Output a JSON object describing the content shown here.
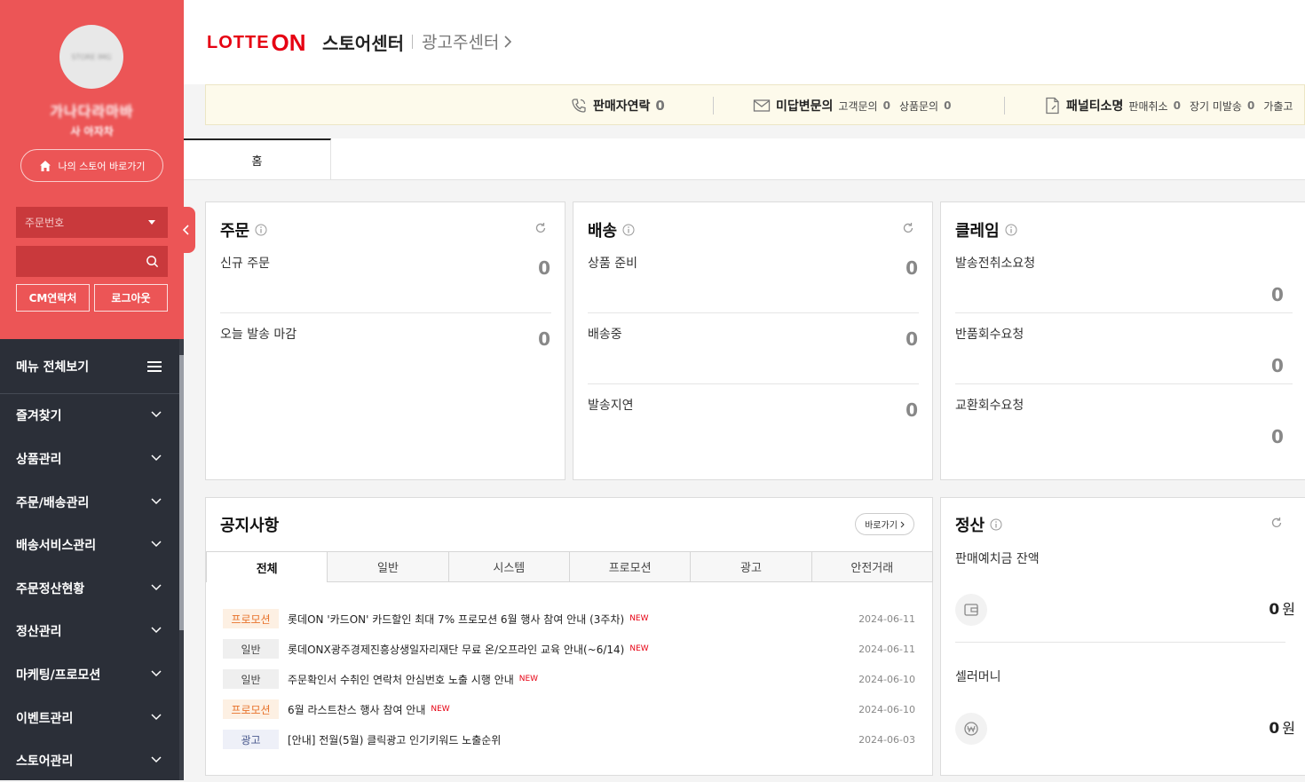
{
  "sidebar": {
    "avatar_text": "STORE IMG",
    "store_name": "가나다라마바",
    "store_sub": "사 아자차",
    "mystore_label": "나의 스토어 바로가기",
    "select_value": "주문번호",
    "search_value": "",
    "cm_label": "CM연락처",
    "logout_label": "로그아웃",
    "menu_all_label": "메뉴 전체보기",
    "menu_items": [
      {
        "label": "즐겨찾기"
      },
      {
        "label": "상품관리"
      },
      {
        "label": "주문/배송관리"
      },
      {
        "label": "배송서비스관리"
      },
      {
        "label": "주문정산현황"
      },
      {
        "label": "정산관리"
      },
      {
        "label": "마케팅/프로모션"
      },
      {
        "label": "이벤트관리"
      },
      {
        "label": "스토어관리"
      }
    ]
  },
  "header": {
    "logo_lotte": "LOTTE",
    "logo_on": "ON",
    "store_center": "스토어센터",
    "ad_center": "광고주센터"
  },
  "notice_bar": {
    "seller_contact_label": "판매자연락",
    "seller_contact_count": "0",
    "unanswered_label": "미답변문의",
    "customer_inquiry_label": "고객문의",
    "customer_inquiry_count": "0",
    "product_inquiry_label": "상품문의",
    "product_inquiry_count": "0",
    "penalty_label": "패널티소명",
    "sale_cancel_label": "판매취소",
    "sale_cancel_count": "0",
    "long_undelivered_label": "장기 미발송",
    "long_undelivered_count": "0",
    "fake_label": "가출고"
  },
  "tabs": {
    "home": "홈"
  },
  "order_card": {
    "title": "주문",
    "rows": [
      {
        "label": "신규 주문",
        "value": "0"
      },
      {
        "label": "오늘 발송 마감",
        "value": "0"
      }
    ]
  },
  "delivery_card": {
    "title": "배송",
    "rows": [
      {
        "label": "상품 준비",
        "value": "0"
      },
      {
        "label": "배송중",
        "value": "0"
      },
      {
        "label": "발송지연",
        "value": "0"
      }
    ]
  },
  "claim_card": {
    "title": "클레임",
    "rows": [
      {
        "label": "발송전취소요청",
        "value": "0"
      },
      {
        "label": "반품회수요청",
        "value": "0"
      },
      {
        "label": "교환회수요청",
        "value": "0"
      }
    ]
  },
  "notice_card": {
    "title": "공지사항",
    "goto_label": "바로가기",
    "tabs": [
      "전체",
      "일반",
      "시스템",
      "프로모션",
      "광고",
      "안전거래"
    ],
    "items": [
      {
        "badge": "프로모션",
        "text": "롯데ON '카드ON' 카드할인 최대 7% 프로모션 6월 행사 참여 안내 (3주차)",
        "new": "NEW",
        "date": "2024-06-11"
      },
      {
        "badge": "일반",
        "text": "롯데ONX광주경제진흥상생일자리재단 무료 온/오프라인 교육 안내(~6/14)",
        "new": "NEW",
        "date": "2024-06-11"
      },
      {
        "badge": "일반",
        "text": "주문확인서 수취인 연락처 안심번호 노출 시행 안내",
        "new": "NEW",
        "date": "2024-06-10"
      },
      {
        "badge": "프로모션",
        "text": "6월 라스트찬스 행사 참여 안내",
        "new": "NEW",
        "date": "2024-06-10"
      },
      {
        "badge": "광고",
        "text": "[안내] 전월(5월) 클릭광고 인기키워드 노출순위",
        "new": "",
        "date": "2024-06-03"
      }
    ]
  },
  "settlement_card": {
    "title": "정산",
    "deposit_label": "판매예치금 잔액",
    "deposit_value": "0",
    "deposit_unit": "원",
    "money_label": "셀러머니",
    "money_value": "0",
    "money_unit": "원"
  },
  "colors": {
    "brand": "#ec5556",
    "sidebar_dark": "#2b2f38",
    "logo_red": "#e60012"
  }
}
